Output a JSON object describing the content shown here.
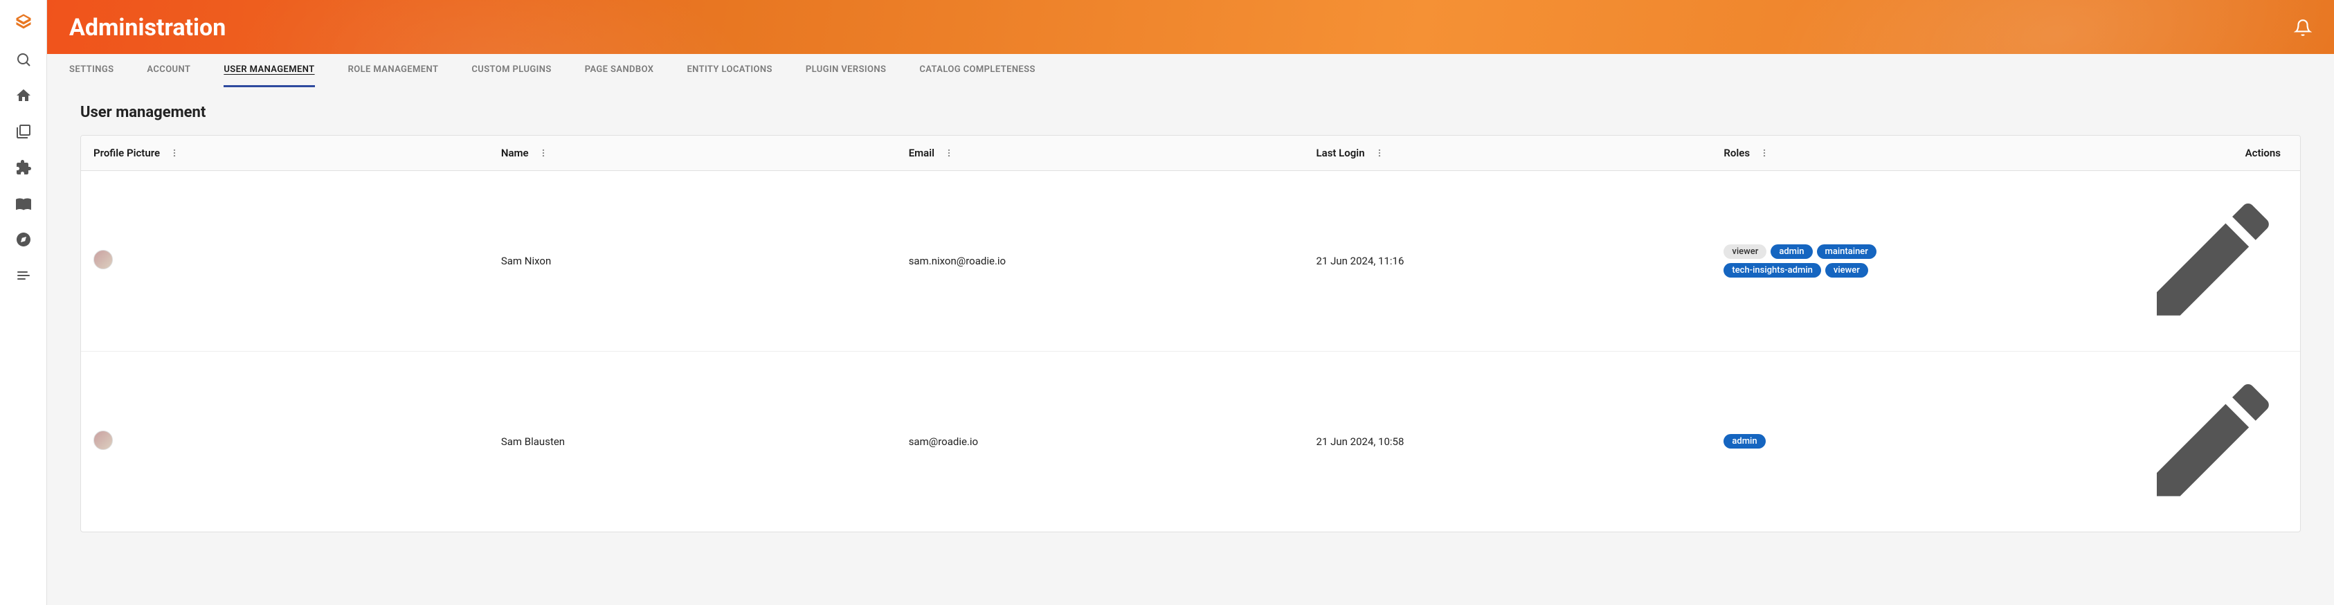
{
  "page_title": "Administration",
  "tabs": [
    {
      "label": "Settings",
      "active": false
    },
    {
      "label": "Account",
      "active": false
    },
    {
      "label": "User Management",
      "active": true
    },
    {
      "label": "Role Management",
      "active": false
    },
    {
      "label": "Custom Plugins",
      "active": false
    },
    {
      "label": "Page Sandbox",
      "active": false
    },
    {
      "label": "Entity Locations",
      "active": false
    },
    {
      "label": "Plugin Versions",
      "active": false
    },
    {
      "label": "Catalog Completeness",
      "active": false
    }
  ],
  "section": {
    "title": "User management"
  },
  "table": {
    "columns": {
      "profile": "Profile Picture",
      "name": "Name",
      "email": "Email",
      "last_login": "Last Login",
      "roles": "Roles",
      "actions": "Actions"
    },
    "rows": [
      {
        "name": "Sam Nixon",
        "email": "sam.nixon@roadie.io",
        "last_login": "21 Jun 2024, 11:16",
        "roles": [
          {
            "label": "viewer",
            "variant": "grey"
          },
          {
            "label": "admin",
            "variant": "blue"
          },
          {
            "label": "maintainer",
            "variant": "blue"
          },
          {
            "label": "tech-insights-admin",
            "variant": "blue"
          },
          {
            "label": "viewer",
            "variant": "blue"
          }
        ]
      },
      {
        "name": "Sam Blausten",
        "email": "sam@roadie.io",
        "last_login": "21 Jun 2024, 10:58",
        "roles": [
          {
            "label": "admin",
            "variant": "blue"
          }
        ]
      }
    ]
  }
}
